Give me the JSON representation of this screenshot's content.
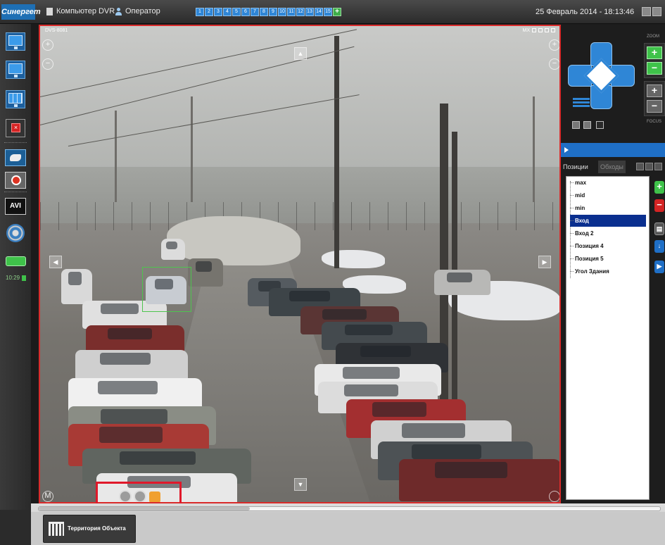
{
  "app": {
    "logo_text": "Синергет",
    "menu_computer": "Компьютер DVR",
    "menu_operator": "Оператор",
    "datetime": "25 Февраль 2014 - 18:13:46"
  },
  "camera_tabs": [
    "1",
    "2",
    "3",
    "4",
    "5",
    "6",
    "7",
    "8",
    "9",
    "10",
    "11",
    "12",
    "13",
    "14",
    "15"
  ],
  "camera_tab_add": "+",
  "left_toolbar": {
    "record_label": "AVI",
    "time": "10:29"
  },
  "video": {
    "camera_name": "DVS-8081",
    "status_text": "MX",
    "zoom_in_symbol": "+",
    "zoom_out_symbol": "−",
    "menu_symbol": "M"
  },
  "ptz": {
    "zoom_label": "ZOOM",
    "focus_label": "FOCUS",
    "plus": "+",
    "minus": "−"
  },
  "positions_panel": {
    "tab_positions": "Позиции",
    "tab_tours": "Обходы",
    "items": [
      "max",
      "mid",
      "min",
      "Вход",
      "Вход 2",
      "Позиция 4",
      "Позиция 5",
      "Угол Здания"
    ],
    "selected_index": 3
  },
  "bottom": {
    "area_button_label": "Территория Объекта"
  },
  "colors": {
    "accent_blue": "#2f86d6",
    "highlight_red": "#e0182a",
    "selection_navy": "#0a2f8f",
    "action_green": "#3fc24a"
  }
}
